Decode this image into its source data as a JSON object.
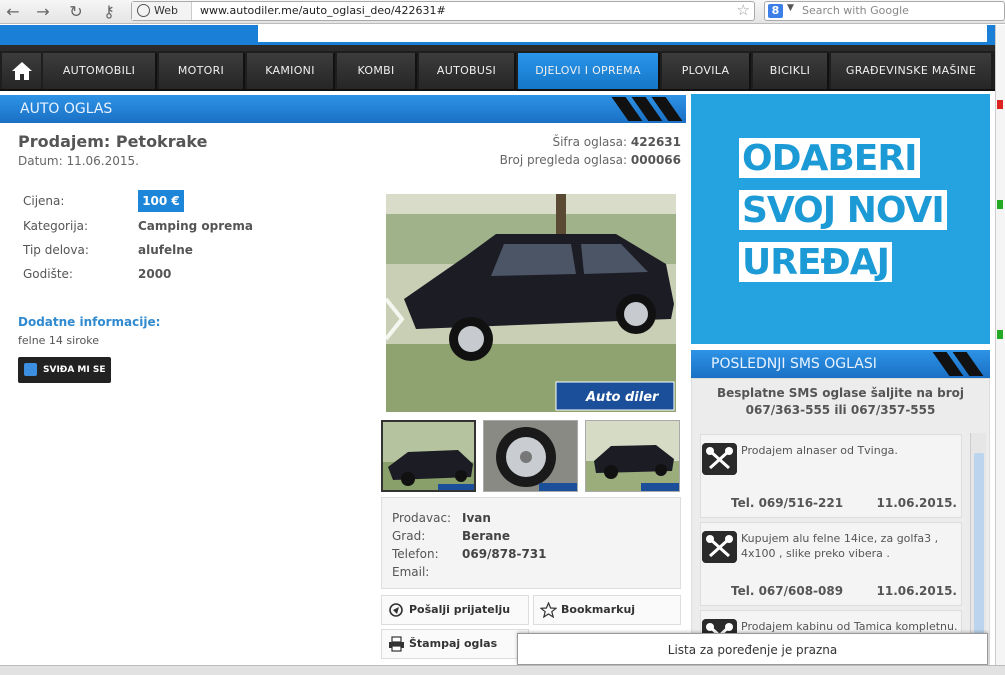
{
  "browser": {
    "web_label": "Web",
    "url": "www.autodiler.me/auto_oglasi_deo/422631#",
    "search_placeholder": "Search with Google",
    "search_logo": "8"
  },
  "nav": {
    "items": [
      "AUTOMOBILI",
      "MOTORI",
      "KAMIONI",
      "KOMBI",
      "AUTOBUSI",
      "DJELOVI I OPREMA",
      "PLOVILA",
      "BICIKLI",
      "GRAĐEVINSKE MAŠINE"
    ],
    "active_index": 5
  },
  "listing": {
    "section_title": "AUTO OGLAS",
    "title": "Prodajem: Petokrake",
    "date": "Datum: 11.06.2015.",
    "id_label": "Šifra oglasa:",
    "id_value": "422631",
    "views_label": "Broj pregleda oglasa:",
    "views_value": "000066",
    "specs": {
      "price_label": "Cijena:",
      "price_value": "100 €",
      "category_label": "Kategorija:",
      "category_value": "Camping oprema",
      "type_label": "Tip delova:",
      "type_value": "alufelne",
      "year_label": "Godište:",
      "year_value": "2000"
    },
    "additional_title": "Dodatne informacije:",
    "additional_text": "felne 14 siroke",
    "like_label": "SVIĐA MI SE",
    "watermark": "Autodiler"
  },
  "seller": {
    "name_label": "Prodavac:",
    "name_value": "Ivan",
    "city_label": "Grad:",
    "city_value": "Berane",
    "phone_label": "Telefon:",
    "phone_value": "069/878-731",
    "email_label": "Email:",
    "email_value": ""
  },
  "actions": {
    "send_friend": "Pošalji prijatelju",
    "bookmark": "Bookmarkuj",
    "print": "Štampaj oglas"
  },
  "ad": {
    "line1": "ODABERI",
    "line2": "SVOJ NOVI",
    "line3": "UREĐAJ"
  },
  "sms": {
    "title": "POSLEDNJI SMS OGLASI",
    "intro_line1": "Besplatne SMS oglase šaljite na broj",
    "intro_line2": "067/363-555 ili 067/357-555",
    "items": [
      {
        "text": "Prodajem alnaser od Tvinga.",
        "tel": "Tel. 069/516-221",
        "date": "11.06.2015."
      },
      {
        "text": "Kupujem alu felne 14ice, za golfa3 , 4x100 , slike preko vibera .",
        "tel": "Tel. 067/608-089",
        "date": "11.06.2015."
      },
      {
        "text": "Prodajem kabinu od Tamica kompletnu.",
        "tel": "",
        "date": ""
      }
    ]
  },
  "compare": {
    "text": "Lista za poređenje je prazna"
  },
  "colors": {
    "brand_blue": "#1e86d8",
    "nav_dark": "#262626",
    "ad_blue": "#25a3e0"
  }
}
